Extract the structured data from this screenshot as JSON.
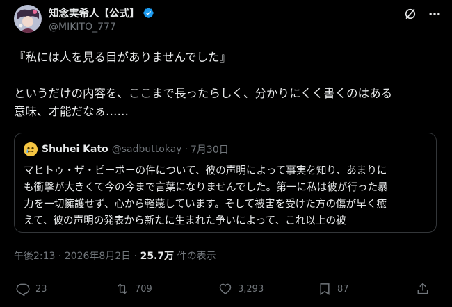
{
  "author": {
    "display_name": "知念実希人【公式】",
    "handle": "@MIKITO_777"
  },
  "tweet": {
    "text": "『私には人を見る目がありませんでした』\n\nというだけの内容を、ここまで長ったらしく、分かりにくく書くのはある\n意味、才能だなぁ……"
  },
  "quote": {
    "display_name": "Shuhei Kato",
    "handle": "@sadbuttokay",
    "separator": "·",
    "date": "7月30日",
    "text": "マヒトゥ・ザ・ピーポーの件について、彼の声明によって事実を知り、あまりに\nも衝撃が大きくて今の今まで言葉になりませんでした。第一に私は彼が行った暴\n力を一切擁護せず、心から軽蔑しています。そして被害を受けた方の傷が早く癒\nえて、彼の声明の発表から新たに生まれた争いによって、これ以上の被"
  },
  "meta": {
    "timestamp": "午後2:13 · 2026年8月2日 · ",
    "views": "25.7万",
    "views_suffix": " 件の表示"
  },
  "actions": {
    "replies": "23",
    "reposts": "709",
    "likes": "3,293",
    "bookmarks": "87"
  },
  "colors": {
    "background": "#000000",
    "text": "#e7e9ea",
    "secondary": "#71767b",
    "border": "#333639",
    "verified": "#1d9bf0"
  },
  "icons": {
    "verified": "verified-badge-icon",
    "grok": "grok-icon",
    "more": "more-icon",
    "reply": "reply-icon",
    "repost": "repost-icon",
    "like": "heart-icon",
    "bookmark": "bookmark-icon",
    "share": "share-icon"
  }
}
